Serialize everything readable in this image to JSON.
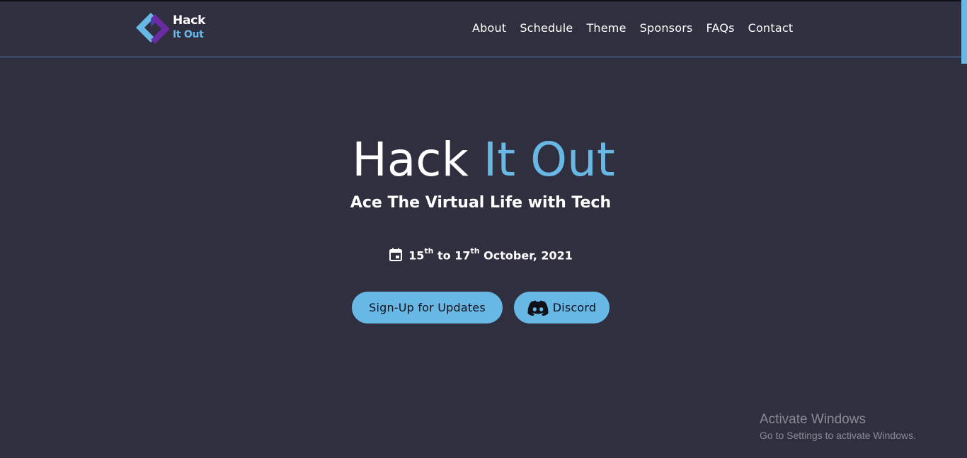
{
  "colors": {
    "background": "#302f40",
    "accent": "#68b8e6",
    "navbar_border": "#4a7db4",
    "button_text": "#11111a"
  },
  "brand": {
    "logo_icon": "hack-it-out-logo",
    "name_top": "Hack",
    "name_bottom": "It Out"
  },
  "nav": {
    "items": [
      {
        "label": "About"
      },
      {
        "label": "Schedule"
      },
      {
        "label": "Theme"
      },
      {
        "label": "Sponsors"
      },
      {
        "label": "FAQs"
      },
      {
        "label": "Contact"
      }
    ]
  },
  "hero": {
    "title_part1": "Hack",
    "title_part2": "It Out",
    "tagline": "Ace The Virtual Life with Tech",
    "date": {
      "icon": "calendar-icon",
      "start_day": "15",
      "start_suffix": "th",
      "to": "to",
      "end_day": "17",
      "end_suffix": "th",
      "month_year": "October, 2021"
    },
    "buttons": {
      "signup_label": "Sign-Up for Updates",
      "discord_label": "Discord",
      "discord_icon": "discord-icon"
    }
  },
  "watermark": {
    "title": "Activate Windows",
    "subtitle": "Go to Settings to activate Windows."
  }
}
